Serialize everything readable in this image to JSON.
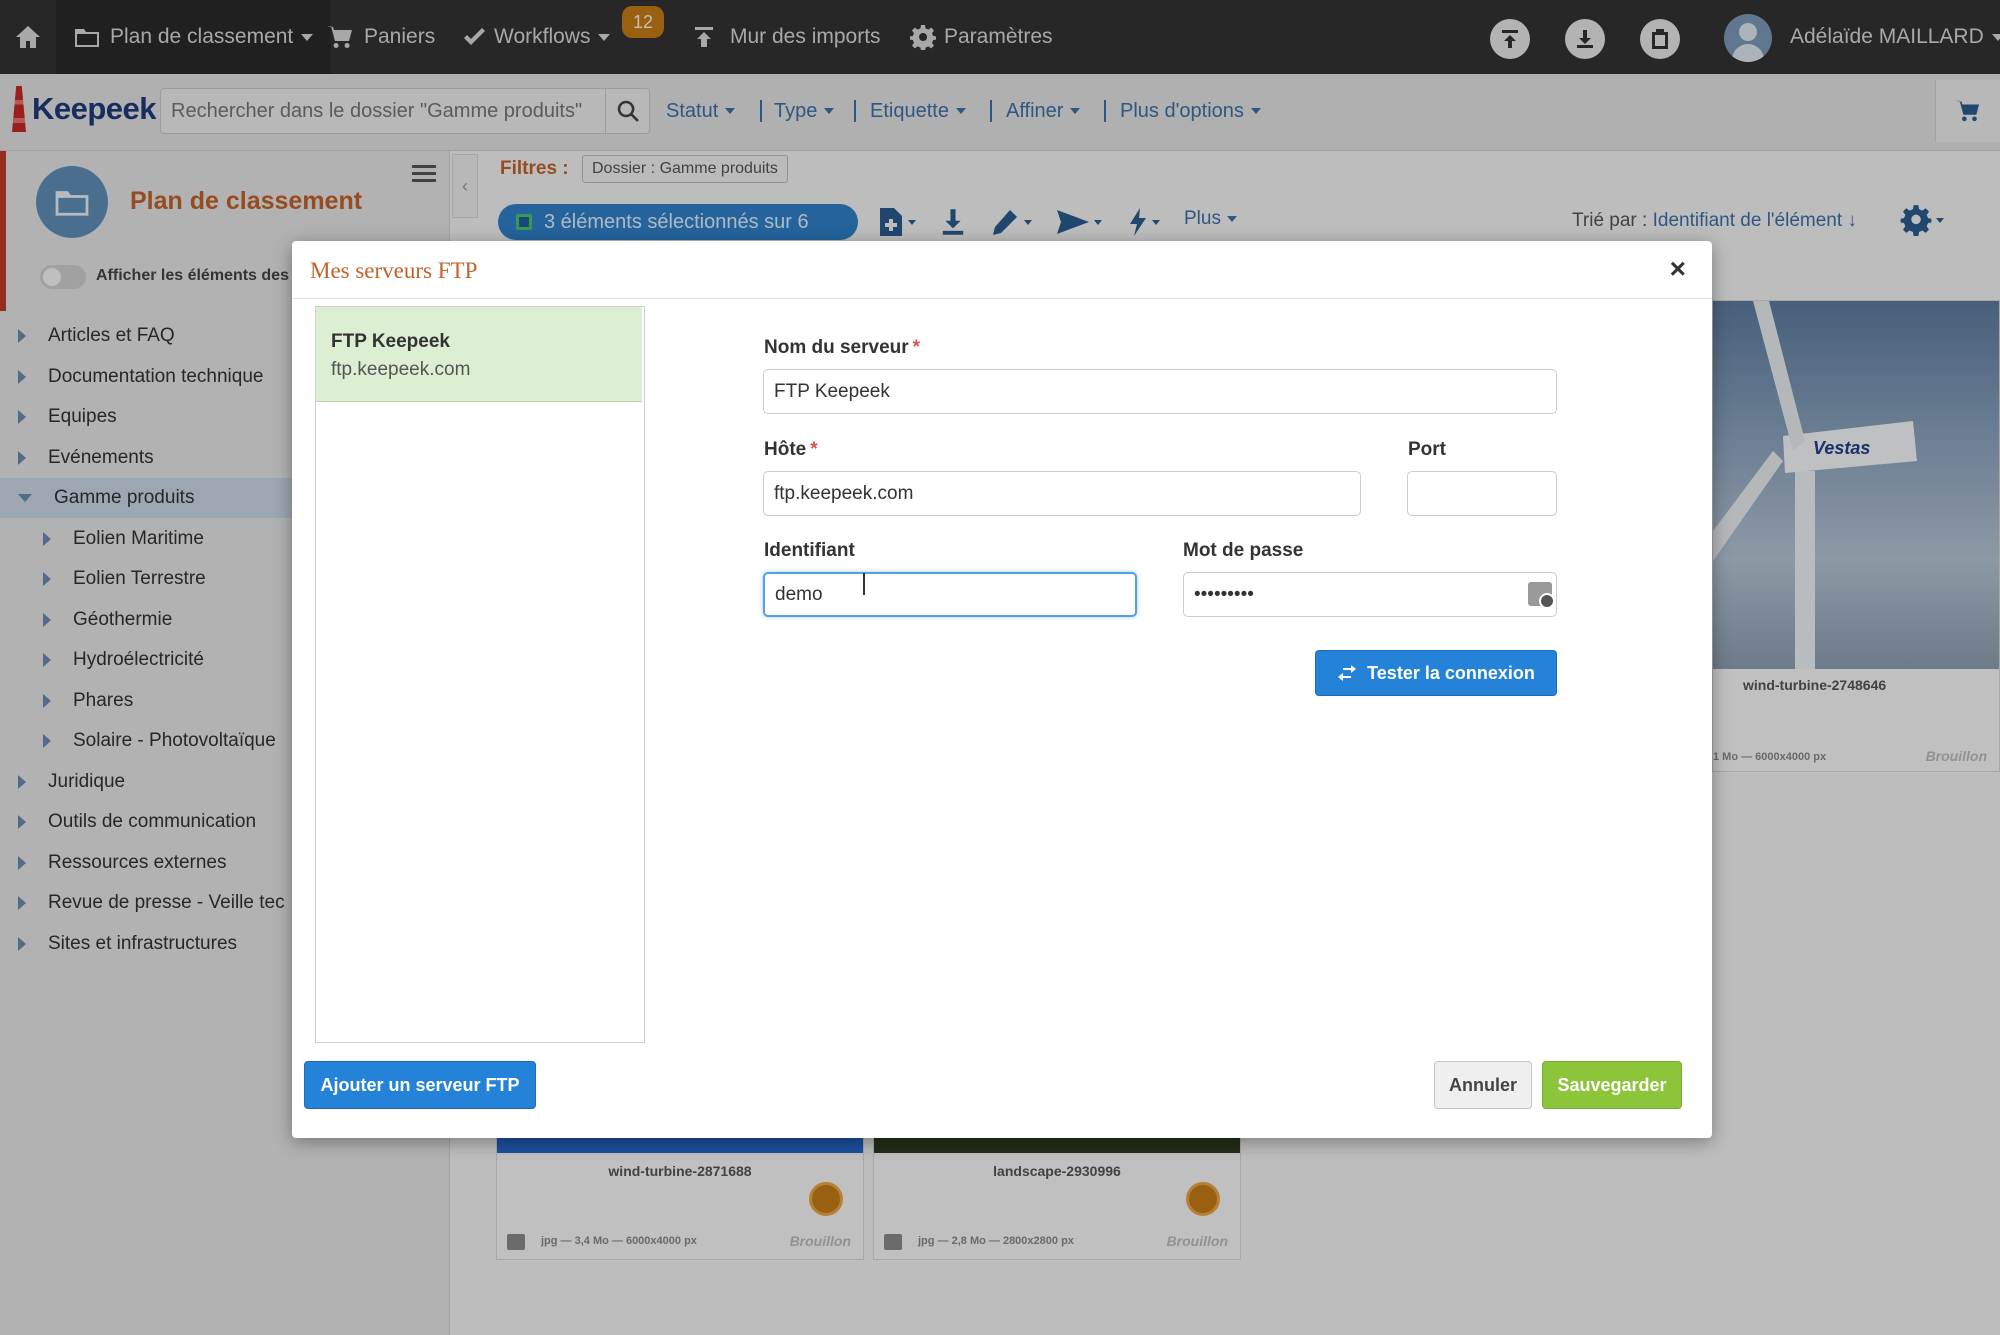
{
  "topbar": {
    "home_icon": "home-icon",
    "plan_label": "Plan de classement",
    "paniers_label": "Paniers",
    "workflows_label": "Workflows",
    "workflows_badge": "12",
    "imports_label": "Mur des imports",
    "settings_label": "Paramètres",
    "user_name": "Adélaïde MAILLARD"
  },
  "subbar": {
    "logo_text": "Keepeek",
    "search_placeholder": "Rechercher dans le dossier \"Gamme produits\"",
    "filters": [
      "Statut",
      "Type",
      "Etiquette",
      "Affiner",
      "Plus d'options"
    ]
  },
  "sidebar": {
    "title": "Plan de classement",
    "toggle_label": "Afficher les éléments des",
    "tree": [
      {
        "label": "Articles et FAQ",
        "level": 0,
        "expanded": false,
        "selected": false
      },
      {
        "label": "Documentation technique",
        "level": 0,
        "expanded": false,
        "selected": false
      },
      {
        "label": "Equipes",
        "level": 0,
        "expanded": false,
        "selected": false
      },
      {
        "label": "Evénements",
        "level": 0,
        "expanded": false,
        "selected": false
      },
      {
        "label": "Gamme produits",
        "level": 0,
        "expanded": true,
        "selected": true
      },
      {
        "label": "Eolien Maritime",
        "level": 1,
        "expanded": false,
        "selected": false
      },
      {
        "label": "Eolien Terrestre",
        "level": 1,
        "expanded": false,
        "selected": false
      },
      {
        "label": "Géothermie",
        "level": 1,
        "expanded": false,
        "selected": false
      },
      {
        "label": "Hydroélectricité",
        "level": 1,
        "expanded": false,
        "selected": false
      },
      {
        "label": "Phares",
        "level": 1,
        "expanded": false,
        "selected": false
      },
      {
        "label": "Solaire - Photovoltaïque",
        "level": 1,
        "expanded": false,
        "selected": false
      },
      {
        "label": "Juridique",
        "level": 0,
        "expanded": false,
        "selected": false
      },
      {
        "label": "Outils de communication",
        "level": 0,
        "expanded": false,
        "selected": false
      },
      {
        "label": "Ressources externes",
        "level": 0,
        "expanded": false,
        "selected": false
      },
      {
        "label": "Revue de presse - Veille tec",
        "level": 0,
        "expanded": false,
        "selected": false
      },
      {
        "label": "Sites et infrastructures",
        "level": 0,
        "expanded": false,
        "selected": false
      }
    ]
  },
  "main": {
    "filters_label": "Filtres :",
    "filter_tag": "Dossier : Gamme produits",
    "selection_label": "3 éléments sélectionnés sur 6",
    "plus_label": "Plus",
    "sort_prefix": "Trié par :",
    "sort_value": "Identifiant de l'élément ↓",
    "cards": [
      {
        "name": "wind-turbine-2748646",
        "meta": "1 Mo — 6000x4000 px",
        "status": "Brouillon"
      },
      {
        "name": "wind-turbine-2871688",
        "meta": "jpg — 3,4 Mo — 6000x4000 px",
        "status": "Brouillon"
      },
      {
        "name": "landscape-2930996",
        "meta": "jpg — 2,8 Mo — 2800x2800 px",
        "status": "Brouillon"
      }
    ]
  },
  "modal": {
    "title": "Mes serveurs FTP",
    "close": "×",
    "server_list": [
      {
        "name": "FTP Keepeek",
        "host": "ftp.keepeek.com"
      }
    ],
    "fields": {
      "server_name_label": "Nom du serveur",
      "server_name_value": "FTP Keepeek",
      "host_label": "Hôte",
      "host_value": "ftp.keepeek.com",
      "port_label": "Port",
      "port_value": "",
      "username_label": "Identifiant",
      "username_value": "demo",
      "password_label": "Mot de passe",
      "password_value": "•••••••••",
      "required_mark": "*"
    },
    "test_button": "Tester la connexion",
    "add_button": "Ajouter un serveur FTP",
    "cancel_button": "Annuler",
    "save_button": "Sauvegarder"
  },
  "colors": {
    "accent_orange": "#c0622a",
    "primary_blue": "#2483d8",
    "save_green": "#8cc43a",
    "selected_server_bg": "#dcefd2"
  }
}
